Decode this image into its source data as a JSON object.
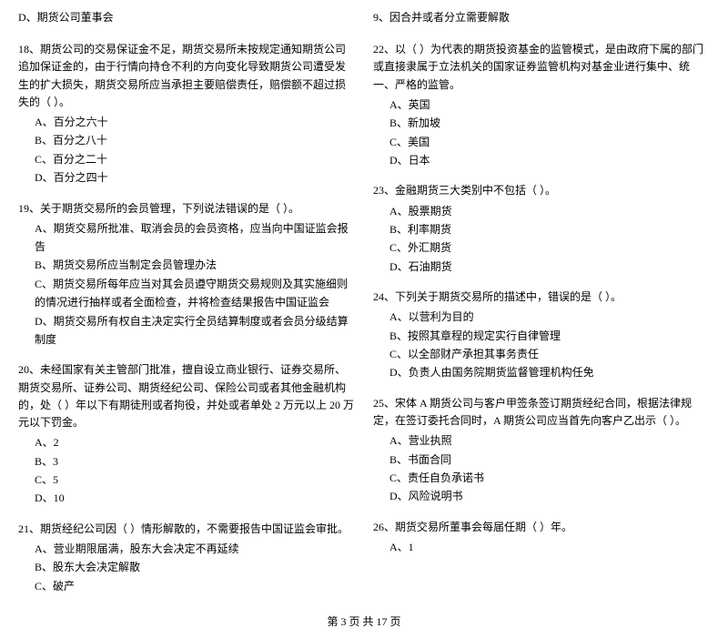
{
  "footer": {
    "text": "第 3 页 共 17 页"
  },
  "left_col": {
    "questions": [
      {
        "id": "q_d_board",
        "text": "D、期货公司董事会",
        "options": []
      },
      {
        "id": "q18",
        "text": "18、期货公司的交易保证金不足，期货交易所未按规定通知期货公司追加保证金的，由于行情向持仓不利的方向变化导致期货公司遭受发生的扩大损失，期货交易所应当承担主要赔偿责任，赔偿额不超过损失的（   ）。",
        "options": [
          {
            "label": "A、百分之六十"
          },
          {
            "label": "B、百分之八十"
          },
          {
            "label": "C、百分之二十"
          },
          {
            "label": "D、百分之四十"
          }
        ]
      },
      {
        "id": "q19",
        "text": "19、关于期货交易所的会员管理，下列说法错误的是（   ）。",
        "options": [
          {
            "label": "A、期货交易所批准、取消会员的会员资格，应当向中国证监会报告"
          },
          {
            "label": "B、期货交易所应当制定会员管理办法"
          },
          {
            "label": "C、期货交易所每年应当对其会员遵守期货交易规则及其实施细则的情况进行抽样或者全面检查，并将检查结果报告中国证监会"
          },
          {
            "label": "D、期货交易所有权自主决定实行全员结算制度或者会员分级结算制度"
          }
        ]
      },
      {
        "id": "q20",
        "text": "20、未经国家有关主管部门批准，擅自设立商业银行、证券交易所、期货交易所、证券公司、期货经纪公司、保险公司或者其他金融机构的，处（   ）年以下有期徒刑或者拘役，并处或者单处 2 万元以上 20 万元以下罚金。",
        "options": [
          {
            "label": "A、2"
          },
          {
            "label": "B、3"
          },
          {
            "label": "C、5"
          },
          {
            "label": "D、10"
          }
        ]
      },
      {
        "id": "q21",
        "text": "21、期货经纪公司因（   ）情形解散的，不需要报告中国证监会审批。",
        "options": [
          {
            "label": "A、营业期限届满，股东大会决定不再延续"
          },
          {
            "label": "B、股东大会决定解散"
          },
          {
            "label": "C、破产"
          }
        ]
      }
    ]
  },
  "right_col": {
    "questions": [
      {
        "id": "q_9_merge",
        "text": "9、因合并或者分立需要解散",
        "options": []
      },
      {
        "id": "q22",
        "text": "22、以（   ）为代表的期货投资基金的监管模式，是由政府下属的部门或直接隶属于立法机关的国家证券监管机构对基金业进行集中、统一、严格的监管。",
        "options": [
          {
            "label": "A、英国"
          },
          {
            "label": "B、新加坡"
          },
          {
            "label": "C、美国"
          },
          {
            "label": "D、日本"
          }
        ]
      },
      {
        "id": "q23",
        "text": "23、金融期货三大类别中不包括（   ）。",
        "options": [
          {
            "label": "A、股票期货"
          },
          {
            "label": "B、利率期货"
          },
          {
            "label": "C、外汇期货"
          },
          {
            "label": "D、石油期货"
          }
        ]
      },
      {
        "id": "q24",
        "text": "24、下列关于期货交易所的描述中，错误的是（   ）。",
        "options": [
          {
            "label": "A、以营利为目的"
          },
          {
            "label": "B、按照其章程的规定实行自律管理"
          },
          {
            "label": "C、以全部财产承担其事务责任"
          },
          {
            "label": "D、负责人由国务院期货监督管理机构任免"
          }
        ]
      },
      {
        "id": "q25",
        "text": "25、宋体 A 期货公司与客户甲签条签订期货经纪合同，根据法律规定，在签订委托合同时，A 期货公司应当首先向客户乙出示（   ）。",
        "options": [
          {
            "label": "A、营业执照"
          },
          {
            "label": "B、书面合同"
          },
          {
            "label": "C、责任自负承诺书"
          },
          {
            "label": "D、风险说明书"
          }
        ]
      },
      {
        "id": "q26",
        "text": "26、期货交易所董事会每届任期（   ）年。",
        "options": [
          {
            "label": "A、1"
          }
        ]
      }
    ]
  }
}
